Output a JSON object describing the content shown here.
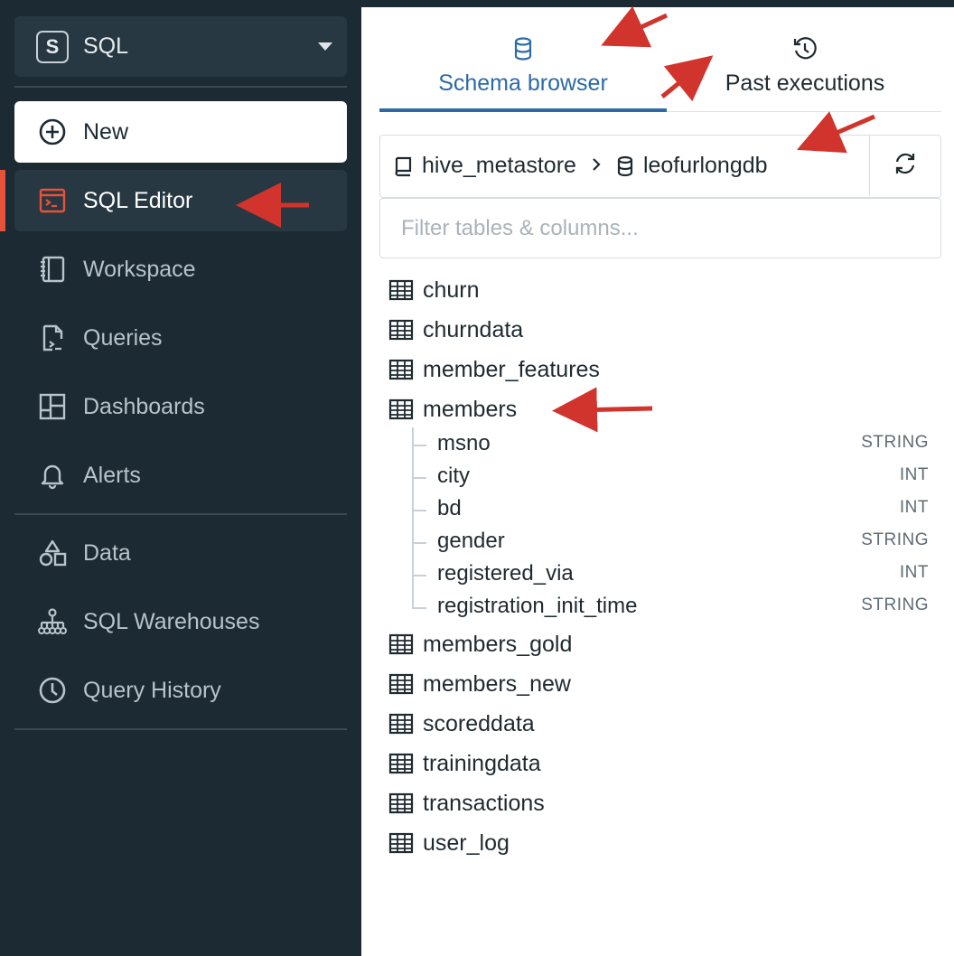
{
  "sidebar": {
    "persona": {
      "badge": "S",
      "label": "SQL"
    },
    "new_label": "New",
    "items": [
      {
        "label": "SQL Editor",
        "icon": "sql-editor-icon",
        "active": true
      },
      {
        "label": "Workspace",
        "icon": "workspace-icon"
      },
      {
        "label": "Queries",
        "icon": "queries-icon"
      },
      {
        "label": "Dashboards",
        "icon": "dashboards-icon"
      },
      {
        "label": "Alerts",
        "icon": "bell-icon"
      },
      {
        "label": "Data",
        "icon": "data-icon"
      },
      {
        "label": "SQL Warehouses",
        "icon": "warehouses-icon"
      },
      {
        "label": "Query History",
        "icon": "clock-icon"
      }
    ]
  },
  "tabs": [
    {
      "label": "Schema browser",
      "icon": "database-icon",
      "active": true
    },
    {
      "label": "Past executions",
      "icon": "history-icon",
      "active": false
    }
  ],
  "breadcrumb": {
    "catalog": "hive_metastore",
    "schema": "leofurlongdb"
  },
  "filter": {
    "placeholder": "Filter tables & columns...",
    "value": ""
  },
  "tables": [
    {
      "name": "churn"
    },
    {
      "name": "churndata"
    },
    {
      "name": "member_features"
    },
    {
      "name": "members",
      "expanded": true,
      "columns": [
        {
          "name": "msno",
          "type": "STRING"
        },
        {
          "name": "city",
          "type": "INT"
        },
        {
          "name": "bd",
          "type": "INT"
        },
        {
          "name": "gender",
          "type": "STRING"
        },
        {
          "name": "registered_via",
          "type": "INT"
        },
        {
          "name": "registration_init_time",
          "type": "STRING"
        }
      ]
    },
    {
      "name": "members_gold"
    },
    {
      "name": "members_new"
    },
    {
      "name": "scoreddata"
    },
    {
      "name": "trainingdata"
    },
    {
      "name": "transactions"
    },
    {
      "name": "user_log"
    }
  ],
  "colors": {
    "sidebar_bg": "#1b2a33",
    "sidebar_item_bg": "#283842",
    "active_indicator": "#e7523a",
    "tab_active": "#2c6aa7",
    "annotation_arrow": "#d0342c"
  }
}
